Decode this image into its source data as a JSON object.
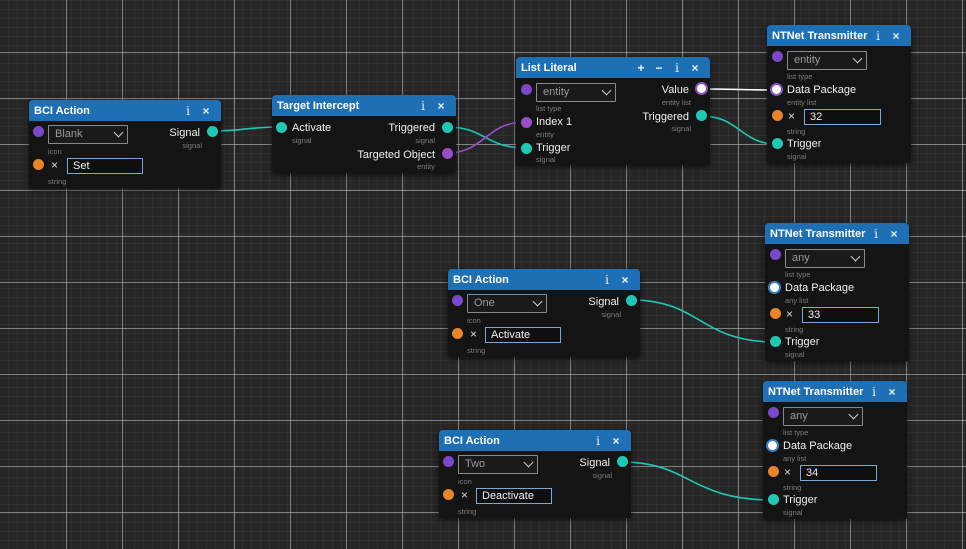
{
  "colors": {
    "signal": "#1ec8b4",
    "entity": "#9a4ec6",
    "string": "#e8842a",
    "header": "#1f6fb4",
    "background": "#262626"
  },
  "icons": {
    "info": "i",
    "close": "×",
    "add": "+",
    "remove": "−",
    "clear": "×"
  },
  "nodes": {
    "bci1": {
      "title": "BCI Action",
      "select": "Blank",
      "select_type": "icon",
      "input": "Set",
      "input_type": "string",
      "out_label": "Signal",
      "out_type": "signal"
    },
    "intercept": {
      "title": "Target Intercept",
      "in_label": "Activate",
      "in_type": "signal",
      "out1_label": "Triggered",
      "out1_type": "signal",
      "out2_label": "Targeted Object",
      "out2_type": "entity"
    },
    "list": {
      "title": "List Literal",
      "select": "entity",
      "select_type": "list type",
      "in1_label": "Index 1",
      "in1_type": "entity",
      "in2_label": "Trigger",
      "in2_type": "signal",
      "out1_label": "Value",
      "out1_type": "entity list",
      "out2_label": "Triggered",
      "out2_type": "signal"
    },
    "tx1": {
      "title": "NTNet Transmitter",
      "select": "entity",
      "select_type": "list type",
      "data_label": "Data Package",
      "data_type": "entity list",
      "input": "32",
      "input_type": "string",
      "trigger_label": "Trigger",
      "trigger_type": "signal"
    },
    "tx2": {
      "title": "NTNet Transmitter",
      "select": "any",
      "select_type": "list type",
      "data_label": "Data Package",
      "data_type": "any list",
      "input": "33",
      "input_type": "string",
      "trigger_label": "Trigger",
      "trigger_type": "signal"
    },
    "bci2": {
      "title": "BCI Action",
      "select": "One",
      "select_type": "icon",
      "input": "Activate",
      "input_type": "string",
      "out_label": "Signal",
      "out_type": "signal"
    },
    "tx3": {
      "title": "NTNet Transmitter",
      "select": "any",
      "select_type": "list type",
      "data_label": "Data Package",
      "data_type": "any list",
      "input": "34",
      "input_type": "string",
      "trigger_label": "Trigger",
      "trigger_type": "signal"
    },
    "bci3": {
      "title": "BCI Action",
      "select": "Two",
      "select_type": "icon",
      "input": "Deactivate",
      "input_type": "string",
      "out_label": "Signal",
      "out_type": "signal"
    }
  }
}
